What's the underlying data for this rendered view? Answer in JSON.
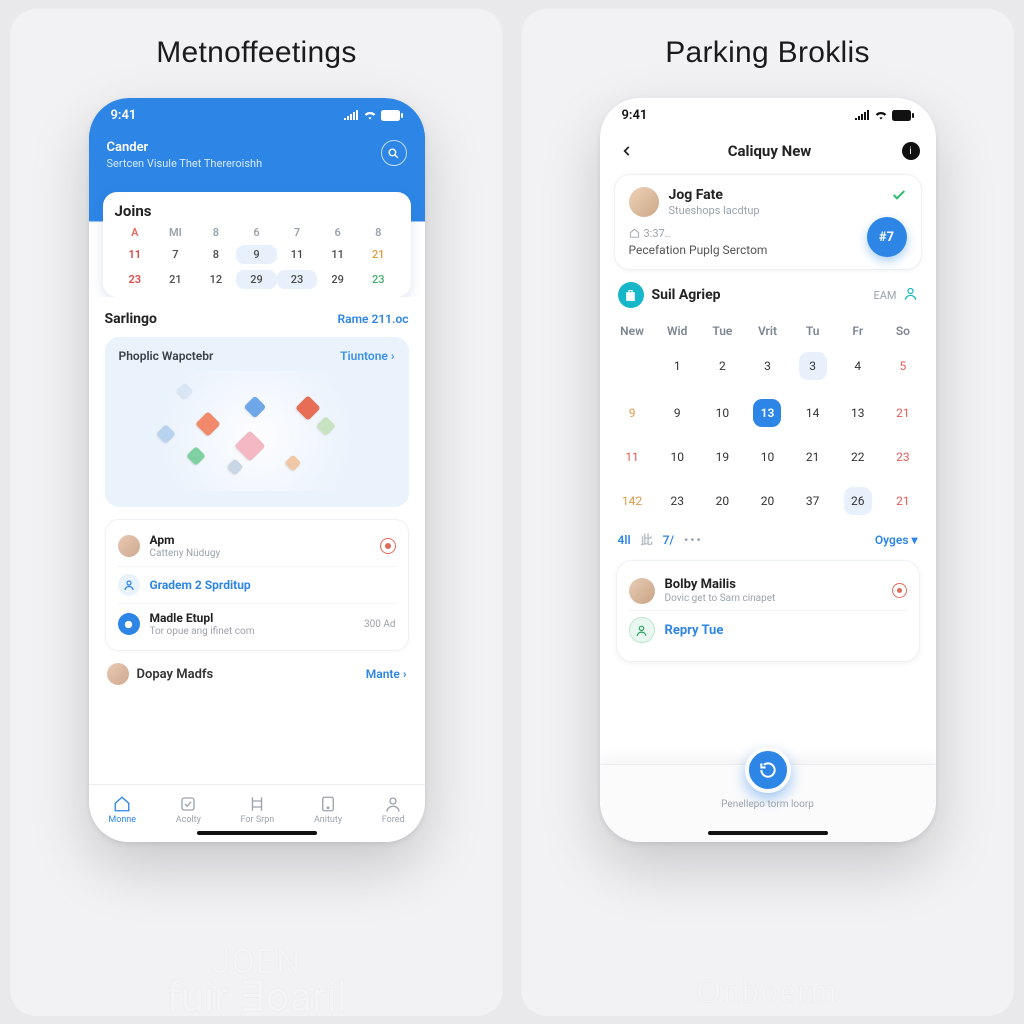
{
  "panels": {
    "left_title": "Metnoffeetings",
    "right_title": "Parking Broklis"
  },
  "status_time": "9:41",
  "left": {
    "header": {
      "title": "Cander",
      "subtitle": "Sertcen Visule Thet Thereroishh"
    },
    "mini_cal": {
      "title": "Joins",
      "days": [
        "A",
        "MI",
        "8",
        "6",
        "7",
        "6",
        "8"
      ],
      "rows": [
        [
          "11",
          "7",
          "8",
          "9",
          "11",
          "11",
          "21"
        ],
        [
          "23",
          "21",
          "12",
          "29",
          "23",
          "29",
          "23"
        ]
      ],
      "red_cols": [
        0
      ],
      "orange_last": 6,
      "green_last_row": 6,
      "selected": [
        [
          0,
          3
        ],
        [
          1,
          3
        ],
        [
          1,
          4
        ]
      ]
    },
    "section": {
      "title": "Sarlingo",
      "link": "Rame 211.oc"
    },
    "widget": {
      "title": "Phoplic Wapctebr",
      "more": "Tiuntone ›"
    },
    "list": [
      {
        "title": "Apm",
        "sub": "Catteny Nüdugy",
        "meta": "",
        "icon": "alert"
      },
      {
        "title": "Gradem 2 Sprditup",
        "sub": "",
        "meta": "",
        "icon": ""
      },
      {
        "title": "Madle Etupl",
        "sub": "Tor opue ang ifinet com",
        "meta": "300 Ad",
        "icon": ""
      }
    ],
    "person": {
      "name": "Dopay Madfs",
      "action": "Mante ›"
    },
    "tabs": [
      "Monne",
      "Acolty",
      "For Srpn",
      "Anituty",
      "Fored"
    ]
  },
  "right": {
    "nav_title": "Caliquy New",
    "user": {
      "name": "Jog Fate",
      "role": "Stueshops lacdtup",
      "stat": "3:37..",
      "desc": "Pecefation Puplg Serctom",
      "fab": "#7"
    },
    "section": {
      "title": "Suil Agriep",
      "meta": "EAM"
    },
    "cal": {
      "days": [
        "New",
        "Wid",
        "Tue",
        "Vrit",
        "Tu",
        "Fr",
        "So"
      ],
      "rows": [
        [
          "",
          "1",
          "2",
          "3",
          "3",
          "4",
          "5"
        ],
        [
          "9",
          "9",
          "10",
          "13",
          "14",
          "13",
          "21"
        ],
        [
          "11",
          "10",
          "19",
          "10",
          "21",
          "22",
          "23"
        ],
        [
          "142",
          "23",
          "20",
          "20",
          "37",
          "26",
          "21"
        ]
      ]
    },
    "filters": {
      "l1": "4ll",
      "l2": "此",
      "l3": "7/",
      "dots": "•••",
      "right": "Oyges ▾"
    },
    "msgs": [
      {
        "title": "Bolby Mailis",
        "sub": "Dovic get to Sarn cinapet",
        "icon": "alert"
      },
      {
        "title": "Repry Tue",
        "sub": "",
        "icon": ""
      }
    ],
    "bottom_text": "Penellepo torm loorp"
  },
  "watermarks": {
    "left_l1": "JOEN",
    "left_l2": "fuir ∃oaril",
    "right": "Onboerm"
  }
}
